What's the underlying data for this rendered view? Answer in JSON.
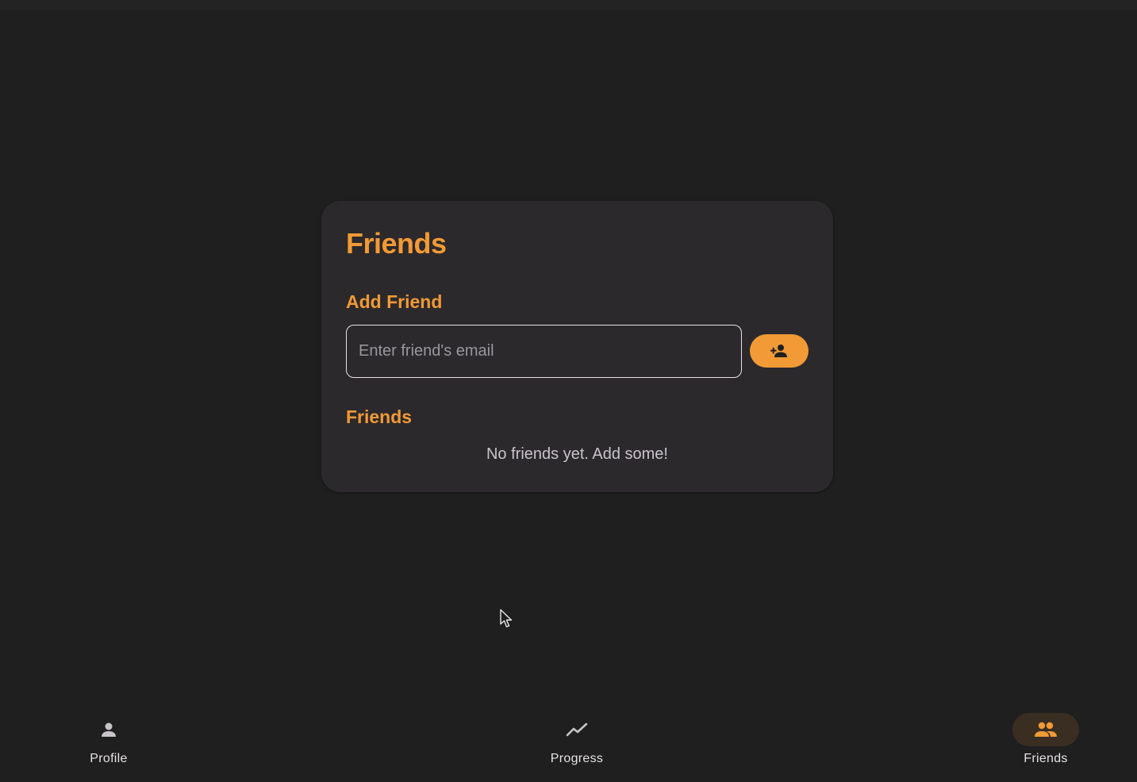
{
  "card": {
    "title": "Friends",
    "add_section_title": "Add Friend",
    "email_placeholder": "Enter friend's email",
    "email_value": "",
    "add_button_icon": "person-add-icon",
    "friends_section_title": "Friends",
    "empty_message": "No friends yet. Add some!"
  },
  "nav": {
    "items": [
      {
        "label": "Profile",
        "icon": "person-icon",
        "active": false
      },
      {
        "label": "Progress",
        "icon": "trending-icon",
        "active": false
      },
      {
        "label": "Friends",
        "icon": "people-icon",
        "active": true
      }
    ]
  },
  "colors": {
    "accent": "#f29a35",
    "background": "#1f1f1f",
    "card": "#2b292c",
    "active_pill": "#3a2e22"
  }
}
